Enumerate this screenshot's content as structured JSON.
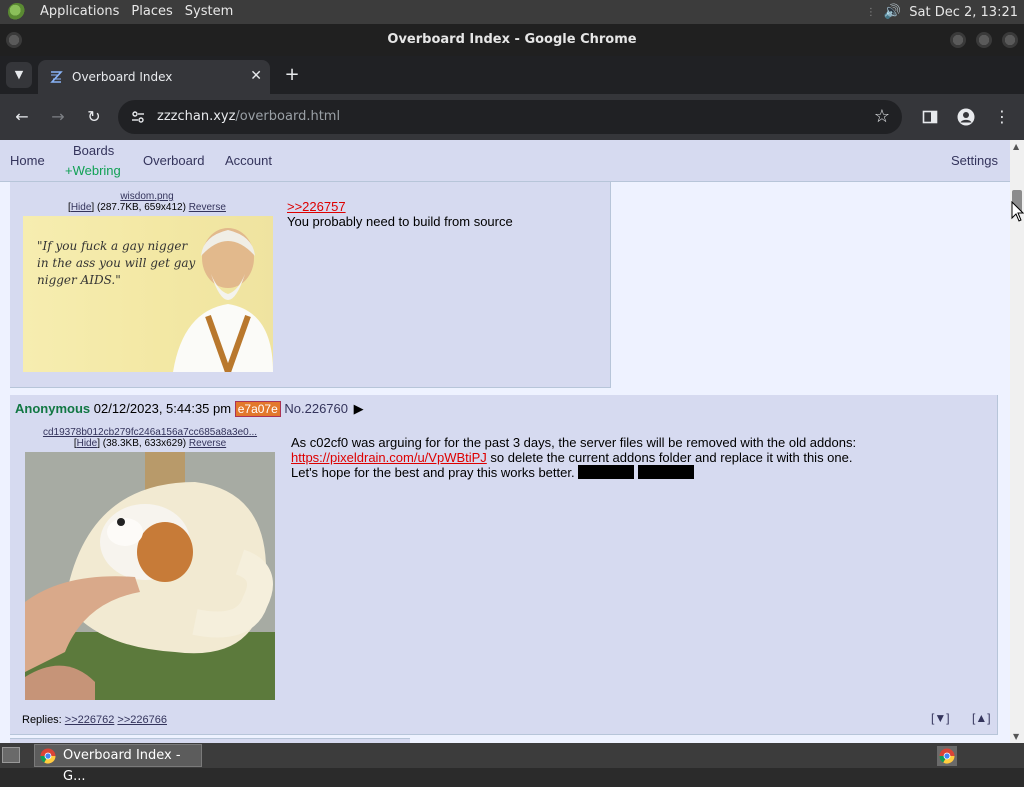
{
  "top_panel": {
    "menus": [
      "Applications",
      "Places",
      "System"
    ],
    "clock": "Sat Dec  2, 13:21"
  },
  "window": {
    "title": "Overboard Index - Google Chrome"
  },
  "browser": {
    "tab_title": "Overboard Index",
    "url_host": "zzzchan.xyz",
    "url_path": "/overboard.html"
  },
  "site_nav": {
    "home": "Home",
    "boards": "Boards",
    "webring": "+Webring",
    "overboard": "Overboard",
    "account": "Account",
    "settings": "Settings"
  },
  "posts": [
    {
      "file_name": "wisdom.png",
      "hide": "Hide",
      "file_meta": "(287.7KB, 659x412)",
      "reverse": "Reverse",
      "image_caption": "\"If you  fuck a gay nigger in the ass you will get gay nigger AIDS.\"",
      "quote": ">>226757",
      "text": "You probably need to build from source"
    },
    {
      "name": "Anonymous",
      "date": "02/12/2023, 5:44:35 pm",
      "poster_id": "e7a07e",
      "number": "No.226760",
      "arrow": "▶",
      "file_name": "cd19378b012cb279fc246a156a7cc685a8a3e0...",
      "hide": "Hide",
      "file_meta": "(38.3KB, 633x629)",
      "reverse": "Reverse",
      "line1": "As c02cf0 was arguing for for the past 3 days, the server files will be removed with the old addons:",
      "link": "https://pixeldrain.com/u/VpWBtiPJ",
      "line2": " so delete the current addons folder and replace it with this one.",
      "line3": "Let's hope for the best and pray this works better. ",
      "replies_label": "Replies: ",
      "replies": [
        ">>226762",
        ">>226766"
      ],
      "nav_down": "[▼]",
      "nav_up": "[▲]"
    }
  ],
  "taskbar": {
    "task_label": "Overboard Index - G..."
  }
}
